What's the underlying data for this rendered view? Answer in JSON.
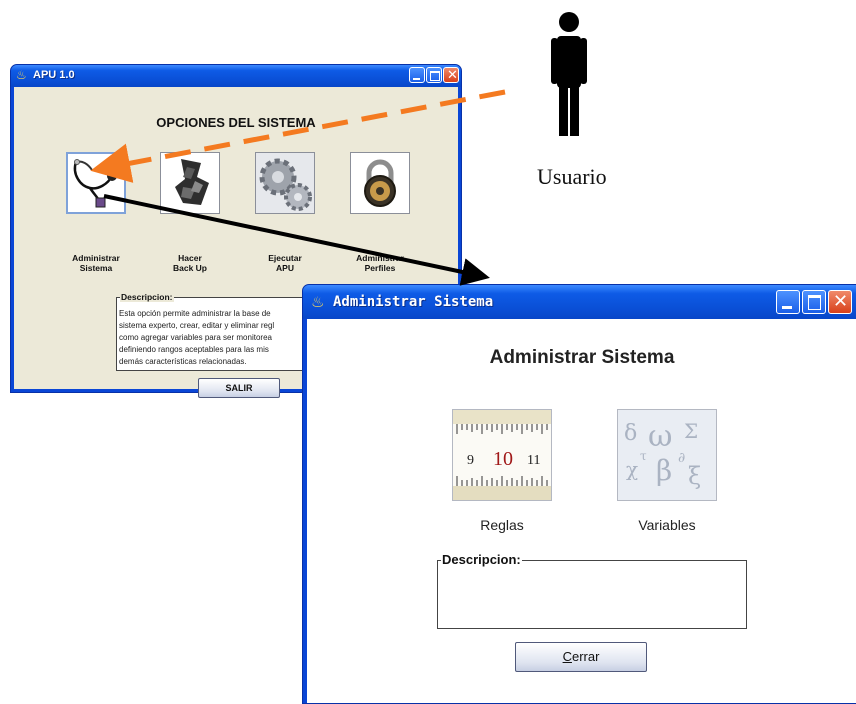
{
  "apu_window": {
    "title": "APU 1.0",
    "heading": "OPCIONES DEL SISTEMA",
    "options": [
      {
        "label_line1": "Administrar",
        "label_line2": "Sistema",
        "icon": "stethoscope-icon"
      },
      {
        "label_line1": "Hacer",
        "label_line2": "Back Up",
        "icon": "puzzle-pieces-icon"
      },
      {
        "label_line1": "Ejecutar",
        "label_line2": "APU",
        "icon": "gears-icon"
      },
      {
        "label_line1": "Administrar",
        "label_line2": "Perfiles",
        "icon": "padlock-icon"
      }
    ],
    "description_legend": "Descripcion:",
    "description_lines": [
      "Esta opción permite administrar la base de",
      "sistema experto, crear, editar y eliminar regl",
      "como agregar variables para ser monitorea",
      "definiendo rangos aceptables para las mis",
      "demás características relacionadas."
    ],
    "salir_label": "SALIR"
  },
  "admin_window": {
    "title": "Administrar Sistema",
    "heading": "Administrar Sistema",
    "options": [
      {
        "label": "Reglas",
        "icon": "ruler-icon"
      },
      {
        "label": "Variables",
        "icon": "variables-symbols-icon"
      }
    ],
    "description_legend": "Descripcion:",
    "cerrar_mnemonic": "C",
    "cerrar_rest": "errar"
  },
  "ruler_numbers": [
    "9",
    "10",
    "11"
  ],
  "person": {
    "label": "Usuario"
  },
  "colors": {
    "titlebar_blue": "#0a4fd6",
    "close_red": "#d8401a",
    "dashed_arrow": "#f47a20",
    "solid_arrow": "#000000"
  }
}
